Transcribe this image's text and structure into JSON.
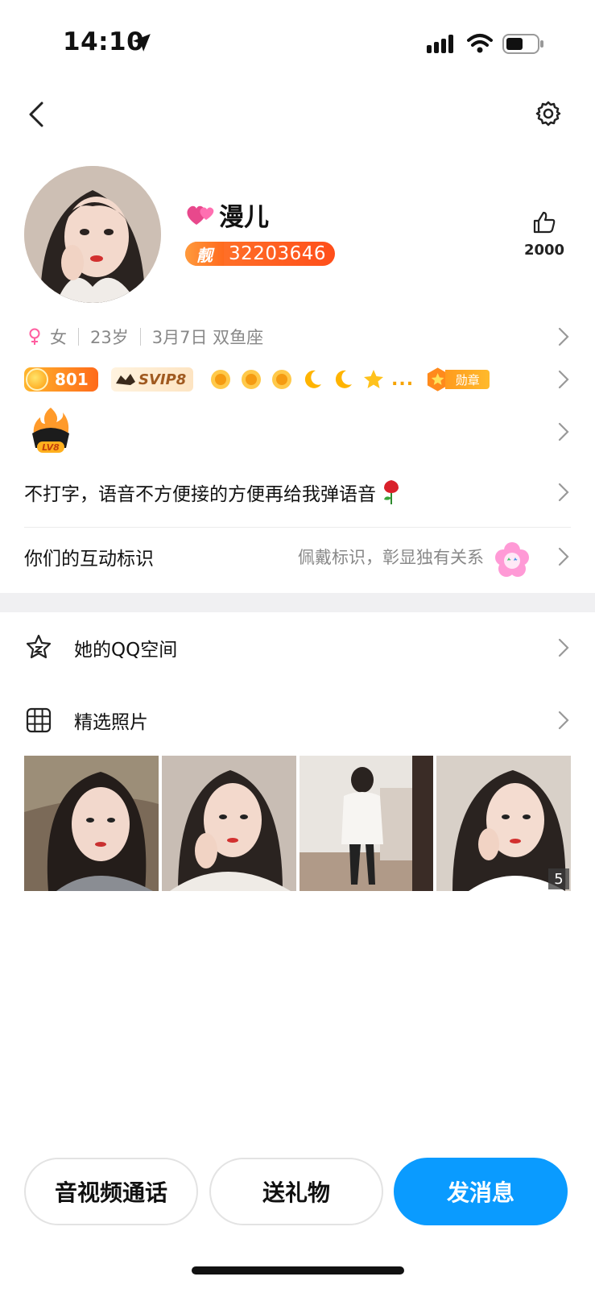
{
  "status_bar": {
    "time": "14:10"
  },
  "profile": {
    "nickname": "漫儿",
    "pretty_tag": "靓",
    "qq_number": "32203646",
    "likes": "2000",
    "gender": "女",
    "age": "23岁",
    "birthday": "3月7日 双鱼座"
  },
  "badges": {
    "gold_level": "801",
    "svip": "SVIP8",
    "more": "...",
    "medal_label": "勋章"
  },
  "lv_label": "LV8",
  "signature": "不打字，语音不方便接的方便再给我弹语音",
  "interaction": {
    "title": "你们的互动标识",
    "hint": "佩戴标识，彰显独有关系"
  },
  "menu": {
    "qzone_label": "她的QQ空间",
    "photos_label": "精选照片",
    "photo_count": "5"
  },
  "actions": {
    "call": "音视频通话",
    "gift": "送礼物",
    "message": "发消息"
  },
  "colors": {
    "accent_blue": "#0a9bff",
    "qq_badge_orange": "#ff5a1f",
    "gold": "#ffa319"
  }
}
